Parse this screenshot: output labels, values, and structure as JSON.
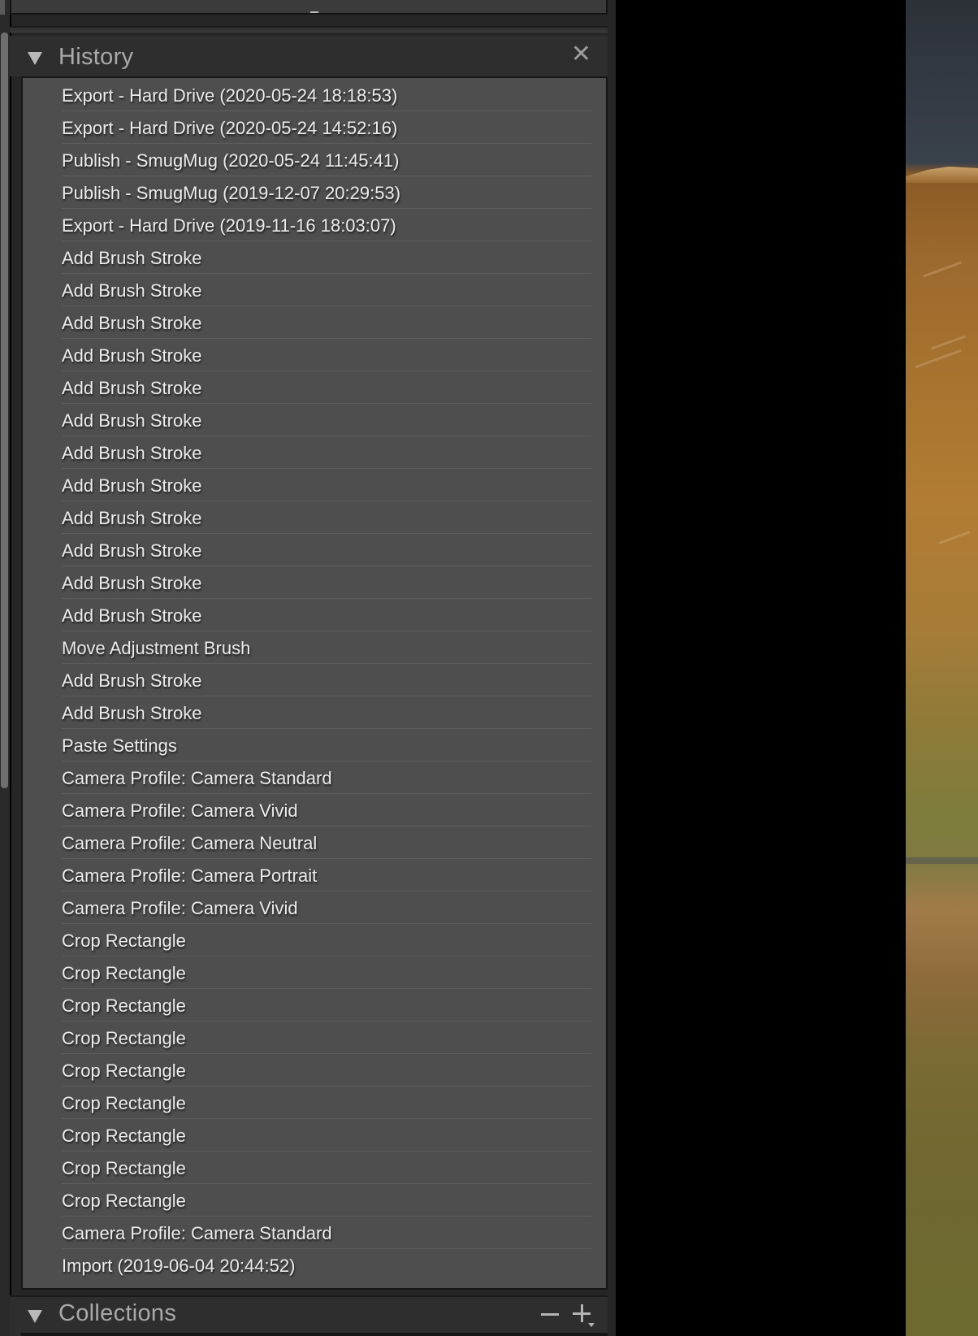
{
  "history": {
    "title": "History",
    "items": [
      "Export - Hard Drive (2020-05-24 18:18:53)",
      "Export - Hard Drive (2020-05-24 14:52:16)",
      "Publish - SmugMug (2020-05-24 11:45:41)",
      "Publish - SmugMug (2019-12-07 20:29:53)",
      "Export - Hard Drive (2019-11-16 18:03:07)",
      "Add Brush Stroke",
      "Add Brush Stroke",
      "Add Brush Stroke",
      "Add Brush Stroke",
      "Add Brush Stroke",
      "Add Brush Stroke",
      "Add Brush Stroke",
      "Add Brush Stroke",
      "Add Brush Stroke",
      "Add Brush Stroke",
      "Add Brush Stroke",
      "Add Brush Stroke",
      "Move Adjustment Brush",
      "Add Brush Stroke",
      "Add Brush Stroke",
      "Paste Settings",
      "Camera Profile: Camera Standard",
      "Camera Profile: Camera Vivid",
      "Camera Profile: Camera Neutral",
      "Camera Profile: Camera Portrait",
      "Camera Profile: Camera Vivid",
      "Crop Rectangle",
      "Crop Rectangle",
      "Crop Rectangle",
      "Crop Rectangle",
      "Crop Rectangle",
      "Crop Rectangle",
      "Crop Rectangle",
      "Crop Rectangle",
      "Crop Rectangle",
      "Camera Profile: Camera Standard",
      "Import (2019-06-04 20:44:52)"
    ]
  },
  "collections": {
    "title": "Collections"
  },
  "icons": {
    "history_toggle": "disclosure-triangle-icon",
    "history_close": "close-icon",
    "collections_toggle": "disclosure-triangle-icon",
    "collections_remove": "minus-icon",
    "collections_add": "plus-icon"
  },
  "colors": {
    "panel_bg": "#2e2e2e",
    "list_bg": "#4e4e4e",
    "text": "#ececec",
    "header_text": "#a9a9a9"
  }
}
